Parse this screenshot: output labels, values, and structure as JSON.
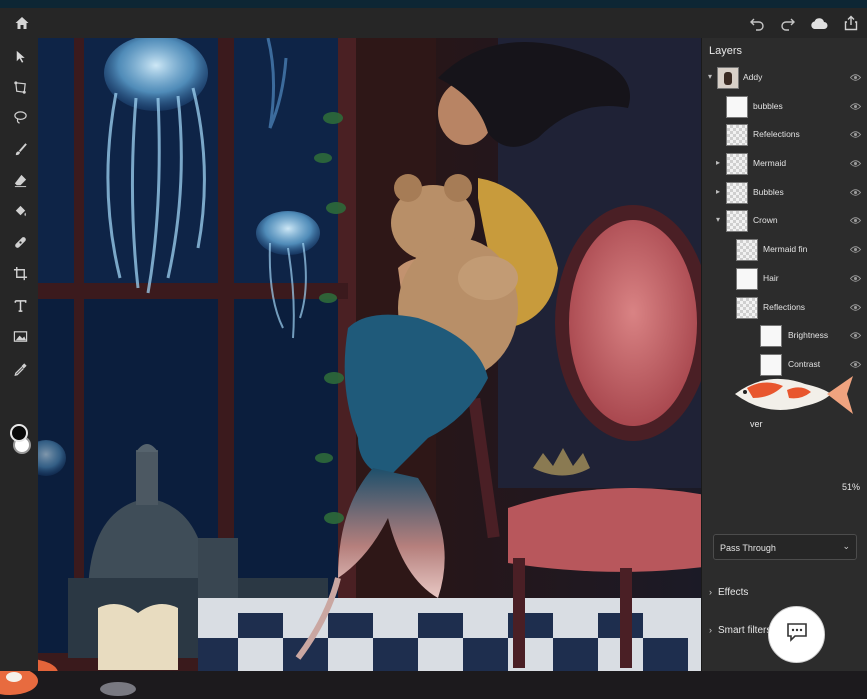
{
  "app": {
    "accent_color": "#1473e6",
    "panel_bg": "#2c2c2c",
    "toolbar_bg": "#262626"
  },
  "header": {
    "home_icon": "home-icon",
    "undo_icon": "undo-icon",
    "redo_icon": "redo-icon",
    "cloud_icon": "cloud-icon",
    "share_icon": "share-icon"
  },
  "toolbar": {
    "tools": [
      "move-icon",
      "transform-icon",
      "lasso-icon",
      "brush-icon",
      "eraser-icon",
      "fill-icon",
      "healing-icon",
      "crop-icon",
      "type-icon",
      "image-icon",
      "eyedropper-icon"
    ],
    "foreground_color": "#0a0a0a",
    "background_color": "#ffffff"
  },
  "layers_panel": {
    "title": "Layers",
    "layers": [
      {
        "label": "Addy",
        "caret": "▾",
        "thumb": "photo"
      },
      {
        "label": "bubbles",
        "caret": "",
        "thumb": "white"
      },
      {
        "label": "Refelections",
        "caret": "",
        "thumb": "checker"
      },
      {
        "label": "Mermaid",
        "caret": "▸",
        "thumb": "checker"
      },
      {
        "label": "Bubbles",
        "caret": "▸",
        "thumb": "checker"
      },
      {
        "label": "Crown",
        "caret": "▾",
        "thumb": "checker"
      },
      {
        "label": "Mermaid fin",
        "caret": "",
        "thumb": "checker"
      },
      {
        "label": "Hair",
        "caret": "",
        "thumb": "white"
      },
      {
        "label": "Reflections",
        "caret": "",
        "thumb": "checker"
      },
      {
        "label": "Brightness",
        "caret": "",
        "thumb": "white"
      },
      {
        "label": "Contrast",
        "caret": "",
        "thumb": "white"
      }
    ],
    "partial_label": "ver",
    "opacity_value": "51%",
    "blend_mode": "Pass Through",
    "sections": [
      "Effects",
      "Smart filters"
    ]
  },
  "comment_icon": "comment-icon"
}
